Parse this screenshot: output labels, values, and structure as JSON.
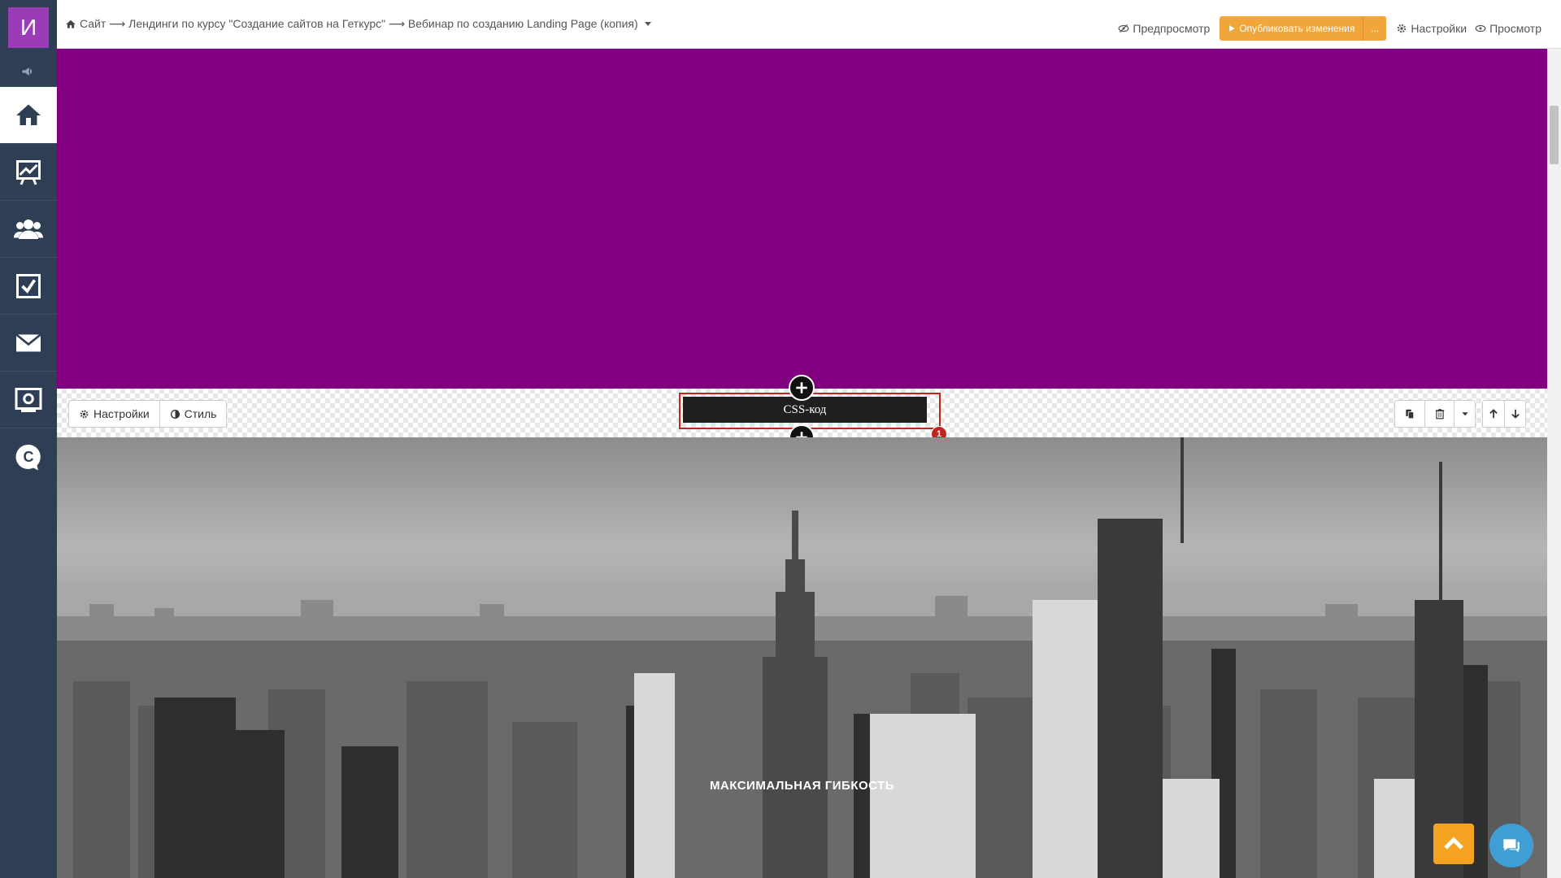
{
  "sidebar": {
    "logo_letter": "И",
    "items": [
      {
        "icon": "home-icon",
        "active": true
      },
      {
        "icon": "chart-icon"
      },
      {
        "icon": "users-icon"
      },
      {
        "icon": "tasks-icon"
      },
      {
        "icon": "mail-icon"
      },
      {
        "icon": "settings-icon"
      },
      {
        "icon": "chat-icon"
      }
    ]
  },
  "topbar": {
    "breadcrumb": "Сайт ⟶ Лендинги по курсу \"Создание сайтов на Геткурс\" ⟶ Вебинар по созданию Landing Page (копия)",
    "preview_label": "Предпросмотр",
    "publish_label": "Опубликовать изменения",
    "publish_more": "...",
    "settings_label": "Настройки",
    "view_label": "Просмотр"
  },
  "editor": {
    "settings_label": "Настройки",
    "style_label": "Стиль",
    "block_label": "CSS-код",
    "badge": "1"
  },
  "hero": {
    "title": "МАКСИМАЛЬНАЯ ГИБКОСТЬ"
  },
  "colors": {
    "purple_section": "#800080",
    "publish_button": "#f0a63b",
    "sidebar": "#2e3f55",
    "selection": "#c0251f"
  }
}
